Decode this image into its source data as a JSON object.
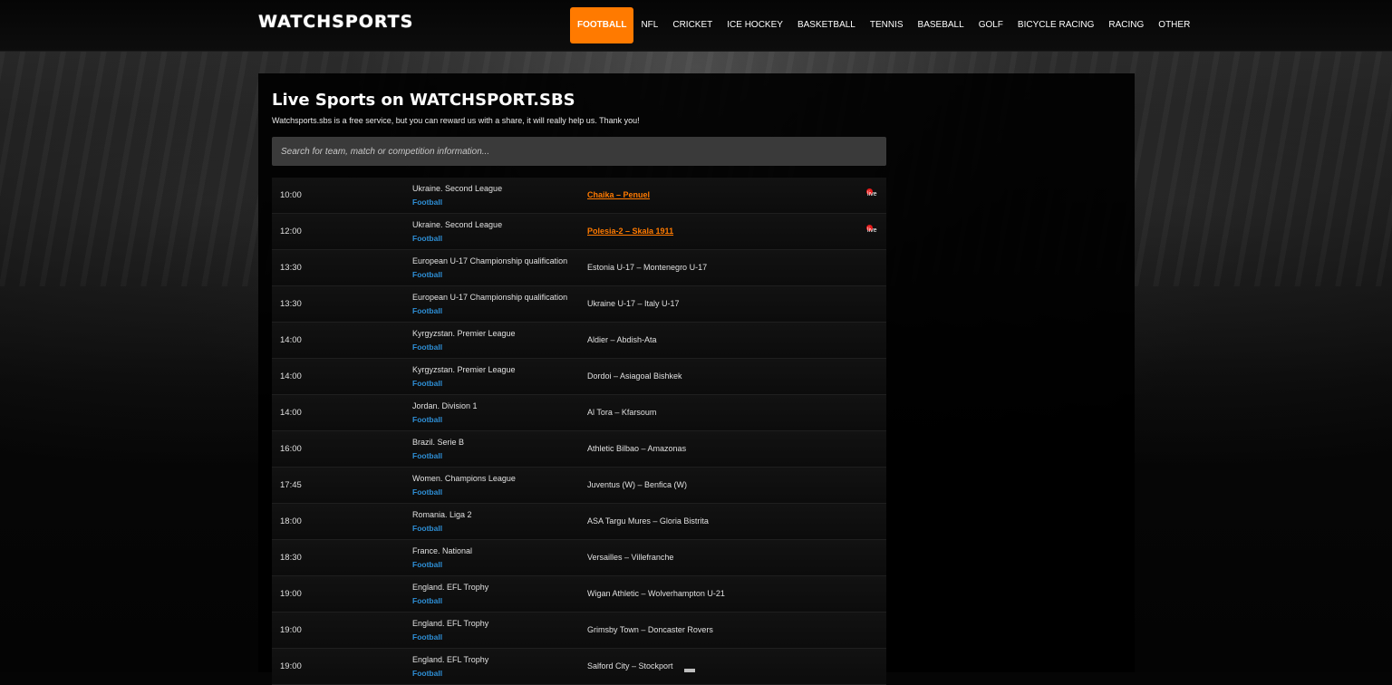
{
  "header": {
    "logo": "WATCHSPORTS",
    "nav": [
      {
        "label": "FOOTBALL",
        "active": true
      },
      {
        "label": "NFL",
        "active": false
      },
      {
        "label": "CRICKET",
        "active": false
      },
      {
        "label": "ICE HOCKEY",
        "active": false
      },
      {
        "label": "BASKETBALL",
        "active": false
      },
      {
        "label": "TENNIS",
        "active": false
      },
      {
        "label": "BASEBALL",
        "active": false
      },
      {
        "label": "GOLF",
        "active": false
      },
      {
        "label": "BICYCLE RACING",
        "active": false
      },
      {
        "label": "RACING",
        "active": false
      },
      {
        "label": "OTHER",
        "active": false
      }
    ]
  },
  "main": {
    "title": "Live Sports on WATCHSPORT.SBS",
    "subtitle": "Watchsports.sbs is a free service, but you can reward us with a share, it will really help us. Thank you!",
    "search_placeholder": "Search for team, match or competition information..."
  },
  "colors": {
    "accent": "#ff7a00",
    "sport_link": "#2e8fd6",
    "live_dot": "#e81b1b"
  },
  "events": [
    {
      "time": "10:00",
      "league": "Ukraine. Second League",
      "sport": "Football",
      "match": "Chaika – Penuel",
      "live": true,
      "live_label": "live"
    },
    {
      "time": "12:00",
      "league": "Ukraine. Second League",
      "sport": "Football",
      "match": "Polesia-2 – Skala 1911",
      "live": true,
      "live_label": "live"
    },
    {
      "time": "13:30",
      "league": "European U-17 Championship qualification",
      "sport": "Football",
      "match": "Estonia U-17 – Montenegro U-17",
      "live": false
    },
    {
      "time": "13:30",
      "league": "European U-17 Championship qualification",
      "sport": "Football",
      "match": "Ukraine U-17 – Italy U-17",
      "live": false
    },
    {
      "time": "14:00",
      "league": "Kyrgyzstan. Premier League",
      "sport": "Football",
      "match": "Aldier – Abdish-Ata",
      "live": false
    },
    {
      "time": "14:00",
      "league": "Kyrgyzstan. Premier League",
      "sport": "Football",
      "match": "Dordoi – Asiagoal Bishkek",
      "live": false
    },
    {
      "time": "14:00",
      "league": "Jordan. Division 1",
      "sport": "Football",
      "match": "Al Tora – Kfarsoum",
      "live": false
    },
    {
      "time": "16:00",
      "league": "Brazil. Serie B",
      "sport": "Football",
      "match": "Athletic Bilbao – Amazonas",
      "live": false
    },
    {
      "time": "17:45",
      "league": "Women. Champions League",
      "sport": "Football",
      "match": "Juventus (W) – Benfica (W)",
      "live": false
    },
    {
      "time": "18:00",
      "league": "Romania. Liga 2",
      "sport": "Football",
      "match": "ASA Targu Mures – Gloria Bistrita",
      "live": false
    },
    {
      "time": "18:30",
      "league": "France. National",
      "sport": "Football",
      "match": "Versailles – Villefranche",
      "live": false
    },
    {
      "time": "19:00",
      "league": "England. EFL Trophy",
      "sport": "Football",
      "match": "Wigan Athletic – Wolverhampton U-21",
      "live": false
    },
    {
      "time": "19:00",
      "league": "England. EFL Trophy",
      "sport": "Football",
      "match": "Grimsby Town – Doncaster Rovers",
      "live": false
    },
    {
      "time": "19:00",
      "league": "England. EFL Trophy",
      "sport": "Football",
      "match": "Salford City – Stockport",
      "live": false
    }
  ]
}
